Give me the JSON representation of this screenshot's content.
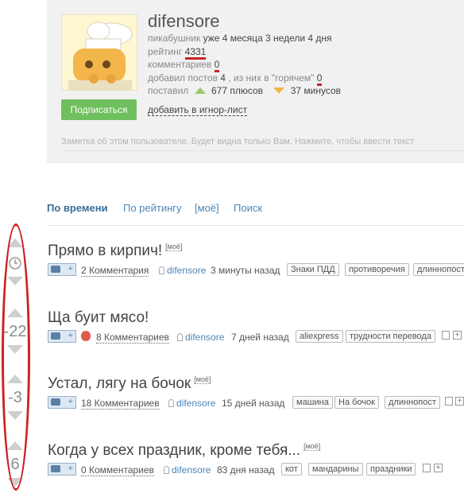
{
  "profile": {
    "username": "difensore",
    "line1_label": "пикабушник",
    "line1_value": "уже 4 месяца 3 недели 4 дня",
    "rating_label": "рейтинг",
    "rating_value": "4331",
    "comments_label": "комментариев",
    "comments_value": "0",
    "posts_prefix": "добавил постов",
    "posts_value": "4",
    "posts_middle": ", из них в \"горячем\"",
    "hot_value": "0",
    "put_label": "поставил",
    "pluses_value": "677 плюсов",
    "minuses_value": "37 минусов",
    "subscribe_label": "Подписаться",
    "ignore_label": "добавить в игнор-лист",
    "note_placeholder": "Заметка об этом пользователе. Будет видна только Вам. Нажмите, чтобы ввести текст"
  },
  "tabs": [
    {
      "label": "По времени",
      "active": true
    },
    {
      "label": "По рейтингу",
      "active": false
    },
    {
      "label": "[моё]",
      "active": false
    },
    {
      "label": "Поиск",
      "active": false
    }
  ],
  "posts": [
    {
      "title": "Прямо в кирпич!",
      "moe": "[моё]",
      "score": "",
      "comments": "2 Комментария",
      "author": "difensore",
      "time": "3 минуты назад",
      "tags": [
        "Знаки ПДД",
        "противоречия",
        "длиннопост"
      ]
    },
    {
      "title": "Ща буит мясо!",
      "moe": "",
      "score": "-22",
      "comments": "8 Комментариев",
      "author": "difensore",
      "time": "7 дней назад",
      "tags": [
        "aliexpress",
        "трудности перевода"
      ]
    },
    {
      "title": "Устал, лягу на бочок",
      "moe": "[моё]",
      "score": "-3",
      "comments": "18 Комментариев",
      "author": "difensore",
      "time": "15 дней назад",
      "tags": [
        "машина",
        "На бочок",
        "длиннопост"
      ]
    },
    {
      "title": "Когда у всех праздник, кроме тебя...",
      "moe": "[моё]",
      "score": "6",
      "comments": "0 Комментариев",
      "author": "difensore",
      "time": "83 дня назад",
      "tags": [
        "кот",
        "мандарины",
        "праздники"
      ]
    }
  ],
  "colors": {
    "accent_link": "#4a86b8",
    "subscribe_green": "#6fbf5e",
    "annotation_red": "#cc2222"
  }
}
